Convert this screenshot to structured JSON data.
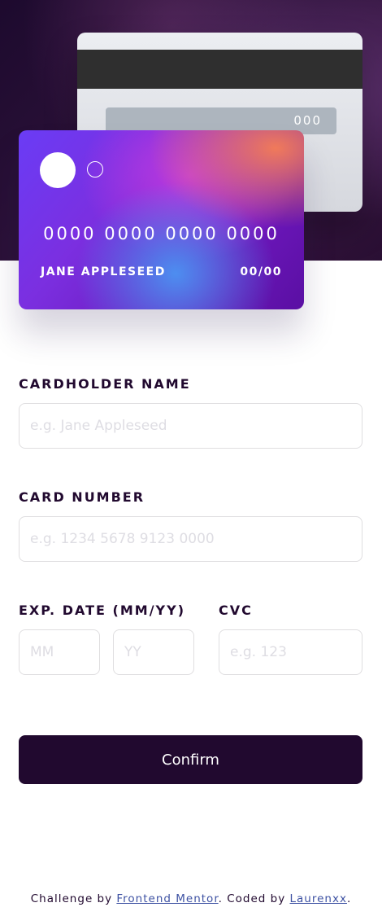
{
  "card_back": {
    "cvc": "000"
  },
  "card_front": {
    "number": "0000 0000 0000 0000",
    "name": "JANE APPLESEED",
    "expiry": "00/00"
  },
  "form": {
    "cardholder_label": "CARDHOLDER NAME",
    "cardholder_placeholder": "e.g. Jane Appleseed",
    "number_label": "CARD NUMBER",
    "number_placeholder": "e.g. 1234 5678 9123 0000",
    "exp_label": "EXP. DATE (MM/YY)",
    "month_placeholder": "MM",
    "year_placeholder": "YY",
    "cvc_label": "CVC",
    "cvc_placeholder": "e.g. 123",
    "confirm_label": "Confirm"
  },
  "footer": {
    "prefix": "Challenge by ",
    "link1": "Frontend Mentor",
    "middle": ". Coded by ",
    "link2": "Laurenxx",
    "suffix": "."
  },
  "colors": {
    "primary_dark": "#21092f",
    "link": "#3e52a3",
    "input_border": "#dfdee0",
    "placeholder": "#dedde3"
  }
}
